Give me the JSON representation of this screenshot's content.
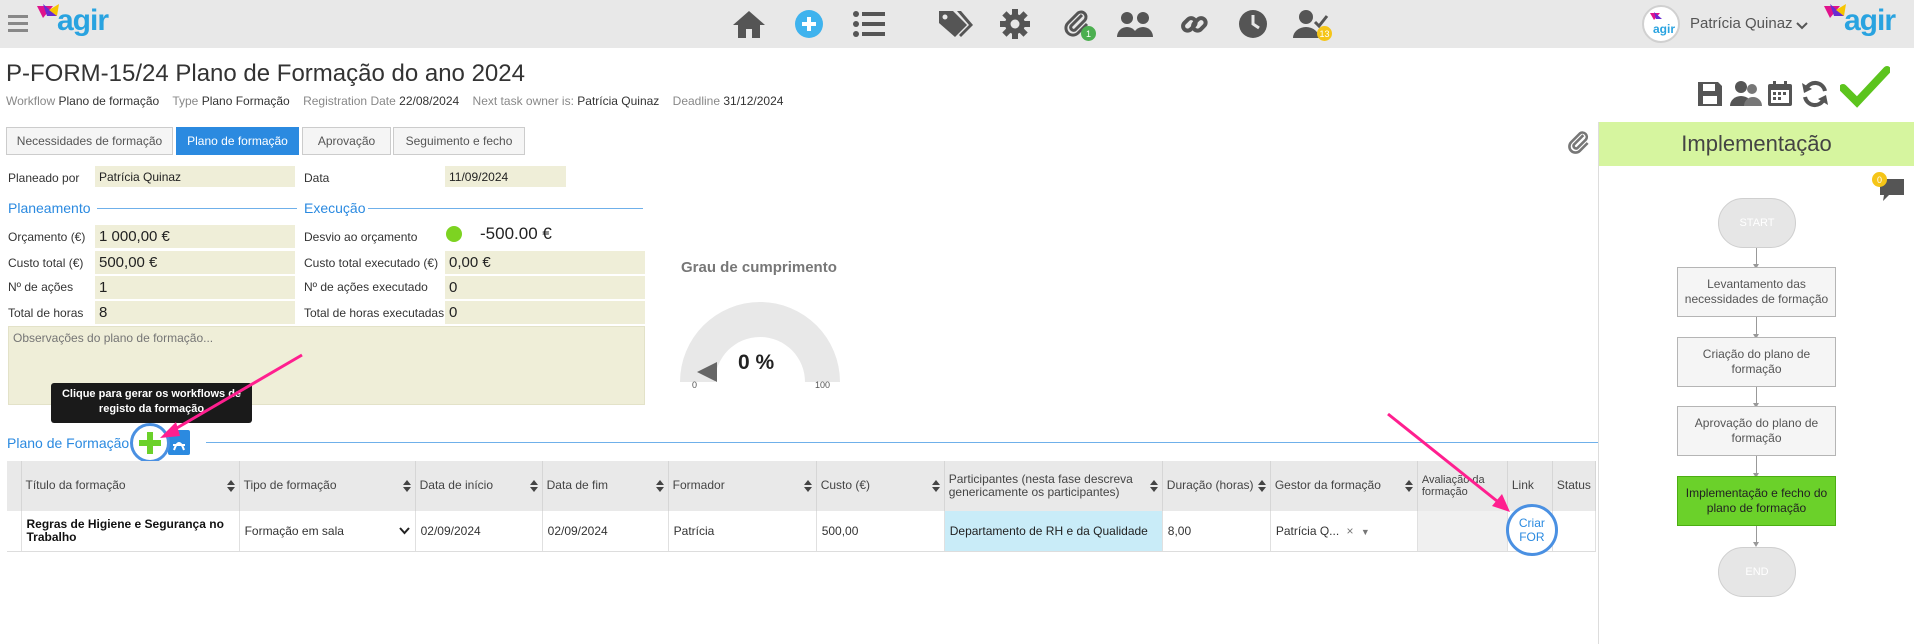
{
  "header": {
    "logo": "agir",
    "user_name": "Patrícia Quinaz",
    "badges": {
      "attachments": "1",
      "tasks": "13"
    },
    "icons": [
      "menu-icon",
      "home-icon",
      "add-icon",
      "list-icon",
      "tags-icon",
      "gear-icon",
      "paperclip-icon",
      "users-icon",
      "link-icon",
      "clock-icon",
      "user-check-icon"
    ]
  },
  "document": {
    "title": "P-FORM-15/24 Plano de Formação do ano 2024",
    "meta": {
      "workflow_label": "Workflow",
      "workflow": "Plano de formação",
      "type_label": "Type",
      "type": "Plano Formação",
      "reg_label": "Registration Date",
      "reg_date": "22/08/2024",
      "owner_label": "Next task owner is:",
      "owner": "Patrícia Quinaz",
      "deadline_label": "Deadline",
      "deadline": "31/12/2024"
    }
  },
  "tabs": [
    {
      "label": "Necessidades de formação",
      "active": false
    },
    {
      "label": "Plano de formação",
      "active": true
    },
    {
      "label": "Aprovação",
      "active": false
    },
    {
      "label": "Seguimento e fecho",
      "active": false
    }
  ],
  "form": {
    "planned_by_label": "Planeado por",
    "planned_by": "Patrícia Quinaz",
    "date_label": "Data",
    "date": "11/09/2024",
    "planning_section": "Planeamento",
    "execution_section": "Execução",
    "budget_label": "Orçamento (€)",
    "budget": "1 000,00 €",
    "deviation_label": "Desvio ao orçamento",
    "deviation": "-500.00 €",
    "deviation_color": "#7dd321",
    "total_cost_label": "Custo total (€)",
    "total_cost": "500,00 €",
    "exec_cost_label": "Custo total executado (€)",
    "exec_cost": "0,00 €",
    "actions_label": "Nº de ações",
    "actions": "1",
    "exec_actions_label": "Nº de ações executado",
    "exec_actions": "0",
    "hours_label": "Total de horas",
    "hours": "8",
    "exec_hours_label": "Total de horas executadas",
    "exec_hours": "0",
    "observations_placeholder": "Observações do plano de formação..."
  },
  "gauge": {
    "title": "Grau de cumprimento",
    "value": "0 %",
    "min": "0",
    "max": "100",
    "fraction": 0
  },
  "tooltip": "Clique para gerar os workflows de registo da formação",
  "plan_section": "Plano de Formação",
  "table": {
    "columns": [
      "Título da formação",
      "Tipo de formação",
      "Data de início",
      "Data de fim",
      "Formador",
      "Custo (€)",
      "Participantes (nesta fase descreva genericamente os participantes)",
      "Duração (horas)",
      "Gestor da formação",
      "Avaliação da formação",
      "Link",
      "Status"
    ],
    "rows": [
      {
        "title": "Regras de Higiene e Segurança no Trabalho",
        "type": "Formação em sala",
        "start": "02/09/2024",
        "end": "02/09/2024",
        "trainer": "Patrícia",
        "cost": "500,00",
        "participants": "Departamento de RH e da Qualidade",
        "duration": "8,00",
        "manager": "Patrícia Q...",
        "evaluation": "",
        "link": "Criar FOR",
        "status": ""
      }
    ]
  },
  "flow": {
    "phase": "Implementação",
    "comments": "0",
    "start": "START",
    "end": "END",
    "steps": [
      {
        "label": "Levantamento das necessidades de formação",
        "active": false
      },
      {
        "label": "Criação do plano de formação",
        "active": false
      },
      {
        "label": "Aprovação do plano de formação",
        "active": false
      },
      {
        "label": "Implementação e fecho do plano de formação",
        "active": true
      }
    ]
  },
  "colors": {
    "accent": "#2b8ae0",
    "phase_bg": "#d6f59f",
    "annotation": "#ff1f8f",
    "highlight": "#4a90e2"
  }
}
